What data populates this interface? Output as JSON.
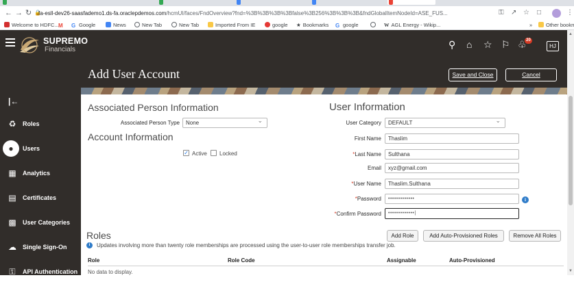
{
  "browser": {
    "url_host": "fa-esll-dev26-saasfademo1.ds-fa.oraclepdemos.com",
    "url_path": "/hcmUI/faces/FndOverview?fnd=%3B%3B%3B%3Bfalse%3B256%3B%3B%3B&fndGlobalItemNodeId=ASE_FUS...",
    "bookmarks": [
      "Welcome to HDFC...",
      "Google",
      "News",
      "New Tab",
      "New Tab",
      "Imported From IE",
      "google",
      "Bookmarks",
      "google",
      "AGL Energy - Wikip..."
    ],
    "other_bookmarks": "Other bookmarks",
    "more_bookmarks": "»"
  },
  "app": {
    "brand": "SUPREMO",
    "brand_sub": "Financials",
    "notification_count": "20",
    "user_initials": "HJ"
  },
  "page": {
    "title": "Add User Account",
    "save_close": "Save and Close",
    "cancel": "Cancel"
  },
  "nav": {
    "collapse": "|←",
    "items": [
      {
        "label": "Roles",
        "icon": "roles-icon"
      },
      {
        "label": "Users",
        "icon": "user-icon"
      },
      {
        "label": "Analytics",
        "icon": "analytics-icon"
      },
      {
        "label": "Certificates",
        "icon": "certificate-icon"
      },
      {
        "label": "User Categories",
        "icon": "categories-icon"
      },
      {
        "label": "Single Sign-On",
        "icon": "cloud-icon"
      },
      {
        "label": "API Authentication",
        "icon": "key-icon"
      }
    ]
  },
  "associated": {
    "heading": "Associated Person Information",
    "type_label": "Associated Person Type",
    "type_value": "None"
  },
  "account": {
    "heading": "Account Information",
    "active_label": "Active",
    "active_checked": true,
    "locked_label": "Locked",
    "locked_checked": false
  },
  "user_info": {
    "heading": "User Information",
    "category_label": "User Category",
    "category_value": "DEFAULT",
    "first_name_label": "First Name",
    "first_name": "Thaslim",
    "last_name_label": "Last Name",
    "last_name": "Sulthana",
    "email_label": "Email",
    "email": "xyz@gmail.com",
    "username_label": "User Name",
    "username": "Thaslim.Sulthana",
    "password_label": "Password",
    "password_mask": "•••••••••••••",
    "confirm_label": "Confirm Password",
    "confirm_mask": "•••••••••••••|",
    "required_mark": "*"
  },
  "roles": {
    "heading": "Roles",
    "add_role": "Add Role",
    "add_auto": "Add Auto-Provisioned Roles",
    "remove_all": "Remove All Roles",
    "note": "Updates involving more than twenty role memberships are processed using the user-to-user role memberships transfer job.",
    "columns": [
      "Role",
      "Role Code",
      "Assignable",
      "Auto-Provisioned"
    ],
    "empty": "No data to display."
  },
  "colors": {
    "header_bg": "#312d2a",
    "accent_blue": "#2f7cc9",
    "required_red": "#d63b25"
  }
}
